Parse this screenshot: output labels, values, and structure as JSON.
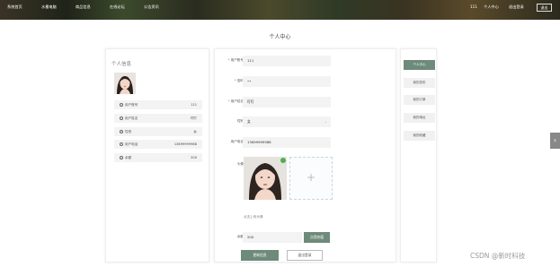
{
  "header": {
    "nav": [
      "系统首页",
      "水墨电脑",
      "商品信息",
      "在线论坛",
      "公告资讯"
    ],
    "user_id": "111",
    "personal_center": "个人中心",
    "admin_text": "退出登录",
    "logout": "退出"
  },
  "page_title": "个人中心",
  "profile": {
    "title": "个人信息",
    "rows": [
      {
        "label": "用户账号",
        "value": "111"
      },
      {
        "label": "用户姓名",
        "value": "叮叮"
      },
      {
        "label": "性别",
        "value": "女"
      },
      {
        "label": "用户电话",
        "value": "13699999988"
      },
      {
        "label": "余额",
        "value": "200"
      }
    ]
  },
  "form": {
    "fields": [
      {
        "label": "用户账号",
        "value": "111",
        "required": true
      },
      {
        "label": "密码",
        "value": "••",
        "required": true
      },
      {
        "label": "用户姓名",
        "value": "叮叮",
        "required": true
      },
      {
        "label": "性别",
        "value": "女",
        "required": false
      },
      {
        "label": "用户电话",
        "value": "13699999988",
        "required": false
      }
    ],
    "avatar_label": "头像",
    "upload_tip": "点击上传头像",
    "balance_label": "余额",
    "balance_value": "200",
    "recharge": "点我充值",
    "update": "更新信息",
    "logout": "退出登录"
  },
  "menu": [
    "个人中心",
    "我的发布",
    "我的订单",
    "我的地址",
    "我的收藏"
  ],
  "watermark": "CSDN @新时科技",
  "colors": {
    "accent": "#6d8a7a"
  }
}
